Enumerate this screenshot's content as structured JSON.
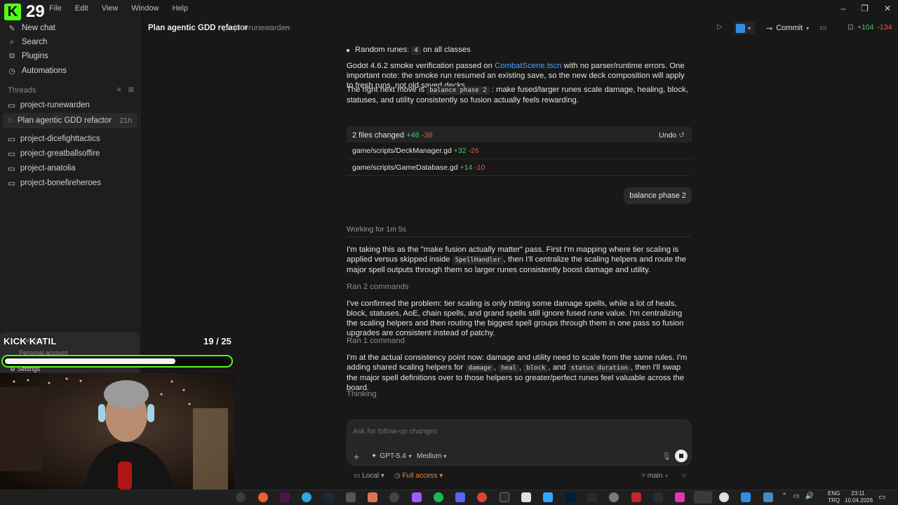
{
  "stream": {
    "channel": "KICK KATIL",
    "logo_number": "29",
    "counter": "19 / 25",
    "progress": 0.76,
    "account_email_partial": "mail.com",
    "account_type": "Personal account",
    "settings_label": "Settings"
  },
  "menu": [
    "File",
    "Edit",
    "View",
    "Window",
    "Help"
  ],
  "sidebar": {
    "items": [
      {
        "label": "New chat",
        "icon": "compose-icon"
      },
      {
        "label": "Search",
        "icon": "search-icon"
      },
      {
        "label": "Plugins",
        "icon": "plugins-icon"
      },
      {
        "label": "Automations",
        "icon": "clock-icon"
      }
    ],
    "threads_label": "Threads",
    "threads": [
      {
        "label": "project-runewarden",
        "age": ""
      },
      {
        "label": "Plan agentic GDD refactor",
        "age": "21h",
        "active": true
      },
      {
        "label": "project-dicefighttactics",
        "age": ""
      },
      {
        "label": "project-greatballsoffire",
        "age": ""
      },
      {
        "label": "project-anatolia",
        "age": ""
      },
      {
        "label": "project-bonefireheroes",
        "age": ""
      }
    ]
  },
  "topbar": {
    "title": "Plan agentic GDD refactor",
    "project": "project-runewarden",
    "commit_label": "Commit",
    "diff_add": "+104",
    "diff_del": "-134"
  },
  "chat": {
    "bullet_prefix": "Random runes:",
    "bullet_code": "4",
    "bullet_suffix": "on all classes",
    "p1_a": "Godot 4.6.2 smoke verification passed on",
    "p1_link": "CombatScene.tscn",
    "p1_b": "with no parser/runtime errors. One important note: the smoke run resumed an existing save, so the new deck composition will apply to fresh runs, not old saved decks.",
    "p2_a": "The right next move is",
    "p2_code": "balance phase 2",
    "p2_b": ": make fused/larger runes scale damage, healing, block, statuses, and utility consistently so fusion actually feels rewarding.",
    "files": {
      "summary": "2 files changed",
      "add": "+46",
      "del": "-36",
      "undo": "Undo",
      "list": [
        {
          "path": "game/scripts/DeckManager.gd",
          "add": "+32",
          "del": "-26"
        },
        {
          "path": "game/scripts/GameDatabase.gd",
          "add": "+14",
          "del": "-10"
        }
      ]
    },
    "user_message": "balance phase 2",
    "working": "Working for 1m 5s",
    "m1_a": "I'm taking this as the \"make fusion actually matter\" pass. First I'm mapping where tier scaling is applied versus skipped inside",
    "m1_code": "SpellHandler",
    "m1_b": ", then I'll centralize the scaling helpers and route the major spell outputs through them so larger runes consistently boost damage and utility.",
    "ran1": "Ran 2 commands",
    "m2": "I've confirmed the problem: tier scaling is only hitting some damage spells, while a lot of heals, block, statuses, AoE, chain spells, and grand spells still ignore fused rune value. I'm centralizing the scaling helpers and then routing the biggest spell groups through them in one pass so fusion upgrades are consistent instead of patchy.",
    "ran2": "Ran 1 command",
    "m3_a": "I'm at the actual consistency point now: damage and utility need to scale from the same rules. I'm adding shared scaling helpers for",
    "m3_c1": "damage",
    "m3_c2": "heal",
    "m3_c3": "block",
    "m3_and": ", and",
    "m3_c4": "status duration",
    "m3_b": ", then I'll swap the major spell definitions over to those helpers so greater/perfect runes feel valuable across the board.",
    "thinking": "Thinking"
  },
  "composer": {
    "placeholder": "Ask for follow-up changes",
    "model": "GPT-5.4",
    "effort": "Medium",
    "env": "Local",
    "access": "Full access",
    "branch": "main"
  },
  "taskbar": {
    "lang_top": "ENG",
    "lang_bottom": "TRQ",
    "time": "23:11",
    "date": "10.04.2026"
  },
  "colors": {
    "accent_kick": "#53fc18",
    "add": "#4fc36b",
    "del": "#e05a5a",
    "link": "#4aa3ff",
    "access": "#e08a3c"
  }
}
